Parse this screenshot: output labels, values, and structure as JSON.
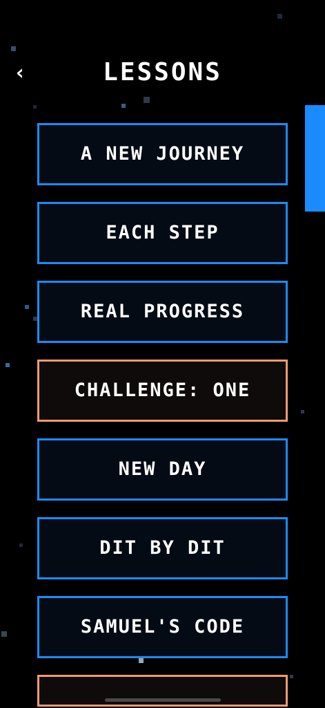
{
  "header": {
    "back_icon": "chevron-left-icon",
    "back_glyph": "‹",
    "title": "Lessons"
  },
  "lessons": [
    {
      "label": "A NEW JOURNEY",
      "kind": "lesson"
    },
    {
      "label": "EACH STEP",
      "kind": "lesson"
    },
    {
      "label": "REAL PROGRESS",
      "kind": "lesson"
    },
    {
      "label": "CHALLENGE: ONE",
      "kind": "challenge"
    },
    {
      "label": "NEW DAY",
      "kind": "lesson"
    },
    {
      "label": "DIT BY DIT",
      "kind": "lesson"
    },
    {
      "label": "SAMUEL'S CODE",
      "kind": "lesson"
    },
    {
      "label": "",
      "kind": "challenge"
    }
  ],
  "colors": {
    "background": "#000000",
    "lesson_border": "#1a8cff",
    "challenge_border": "#f29b6e",
    "text": "#ffffff",
    "scrollbar": "#1a8cff"
  }
}
